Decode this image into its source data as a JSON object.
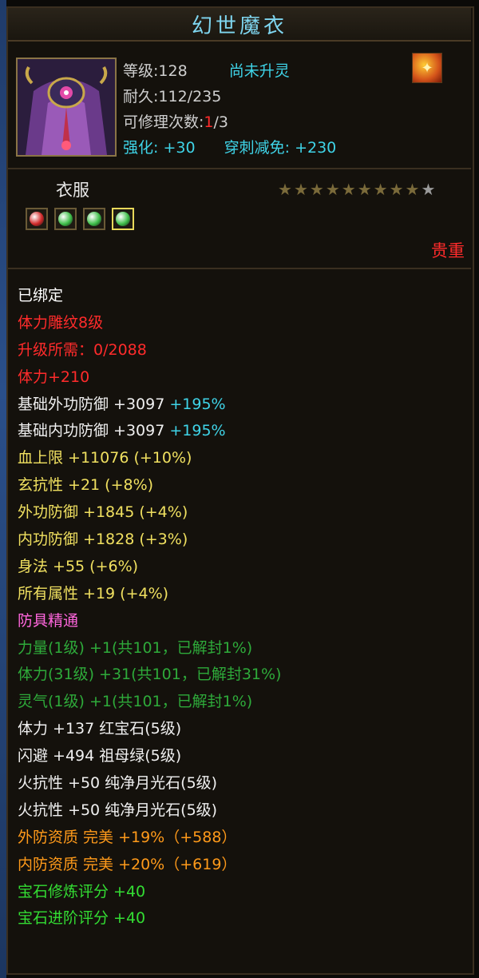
{
  "title": "幻世魔衣",
  "header": {
    "level_label": "等级:",
    "level_value": "128",
    "soul_status": "尚未升灵",
    "durability_label": "耐久:",
    "durability_value": "112/235",
    "repair_label": "可修理次数:",
    "repair_used": "1",
    "repair_total": "/3",
    "enhance_label": "强化:",
    "enhance_value": "+30",
    "pierce_label": "穿刺减免:",
    "pierce_value": "+230"
  },
  "slot": {
    "label": "衣服"
  },
  "stars": {
    "filled": 9,
    "total": 10
  },
  "gems": [
    {
      "icon": "red-gem-icon",
      "color": "#d22a2a"
    },
    {
      "icon": "green-gem-icon",
      "color": "#3fbf4a"
    },
    {
      "icon": "green-gem-icon",
      "color": "#3fbf4a"
    },
    {
      "icon": "green-gem-icon",
      "color": "#3fbf4a"
    }
  ],
  "rarity": "贵重",
  "props": [
    {
      "text": "已绑定",
      "color": "#ffffff"
    },
    {
      "text": "体力雕纹8级",
      "color": "#ff2b2b"
    },
    {
      "text": "升级所需：0/2088",
      "color": "#ff2b2b"
    },
    {
      "text": "体力+210",
      "color": "#ff2b2b"
    },
    {
      "text": "基础外功防御 +3097",
      "color": "#f0f0f0",
      "extra": " +195%",
      "extra_color": "#3fd4e8"
    },
    {
      "text": "基础内功防御 +3097",
      "color": "#f0f0f0",
      "extra": " +195%",
      "extra_color": "#3fd4e8"
    },
    {
      "text": "血上限 +11076 (+10%)",
      "color": "#f0e060"
    },
    {
      "text": "玄抗性 +21 (+8%)",
      "color": "#f0e060"
    },
    {
      "text": "外功防御 +1845 (+4%)",
      "color": "#f0e060"
    },
    {
      "text": "内功防御 +1828 (+3%)",
      "color": "#f0e060"
    },
    {
      "text": "身法 +55 (+6%)",
      "color": "#f0e060"
    },
    {
      "text": "所有属性 +19 (+4%)",
      "color": "#f0e060"
    },
    {
      "text": "防具精通",
      "color": "#ff66dd"
    },
    {
      "text": "力量(1级) +1(共101，已解封1%)",
      "color": "#2eaa3a"
    },
    {
      "text": "体力(31级) +31(共101，已解封31%)",
      "color": "#2eaa3a"
    },
    {
      "text": "灵气(1级) +1(共101，已解封1%)",
      "color": "#2eaa3a"
    },
    {
      "text": "体力 +137 红宝石(5级)",
      "color": "#f0f0f0"
    },
    {
      "text": "闪避 +494 祖母绿(5级)",
      "color": "#f0f0f0"
    },
    {
      "text": "火抗性 +50 纯净月光石(5级)",
      "color": "#f0f0f0"
    },
    {
      "text": "火抗性 +50 纯净月光石(5级)",
      "color": "#f0f0f0"
    },
    {
      "text": "外防资质  完美 +19%（+588）",
      "color": "#ff9a1a"
    },
    {
      "text": "内防资质  完美 +20%（+619）",
      "color": "#ff9a1a"
    },
    {
      "text": "宝石修炼评分 +40",
      "color": "#33dd33"
    },
    {
      "text": "宝石进阶评分 +40",
      "color": "#33dd33"
    }
  ]
}
